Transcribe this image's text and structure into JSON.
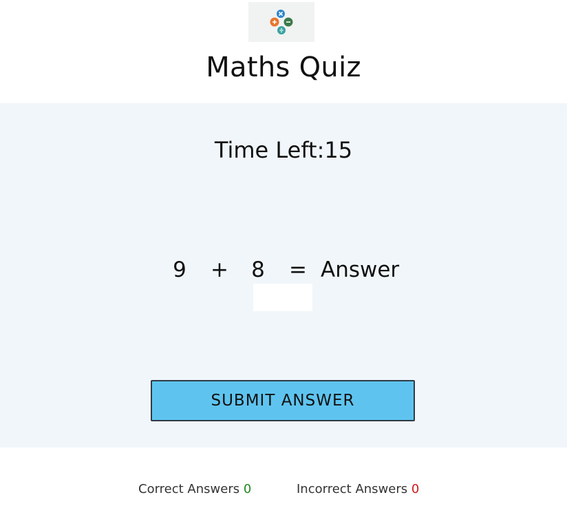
{
  "header": {
    "logo_alt": "math operations logo",
    "title": "Maths Quiz"
  },
  "timer": {
    "label": "Time Left:",
    "value": "15"
  },
  "question": {
    "operand1": "9",
    "operator": "+",
    "operand2": "8",
    "equals": "=",
    "answer_label": "Answer"
  },
  "answer": {
    "value": "",
    "placeholder": ""
  },
  "submit_label": "SUBMIT ANSWER",
  "score": {
    "correct_label": "Correct Answers",
    "correct_value": "0",
    "incorrect_label": "Incorrect Answers",
    "incorrect_value": "0"
  },
  "colors": {
    "accent": "#5ec4ef",
    "panel": "#f1f6fa",
    "correct": "#1f8a1f",
    "incorrect": "#d11a1a",
    "logo_orange": "#e8752c",
    "logo_blue": "#2c86c9",
    "logo_green": "#3b7a4a",
    "logo_teal": "#3aa3a0"
  }
}
